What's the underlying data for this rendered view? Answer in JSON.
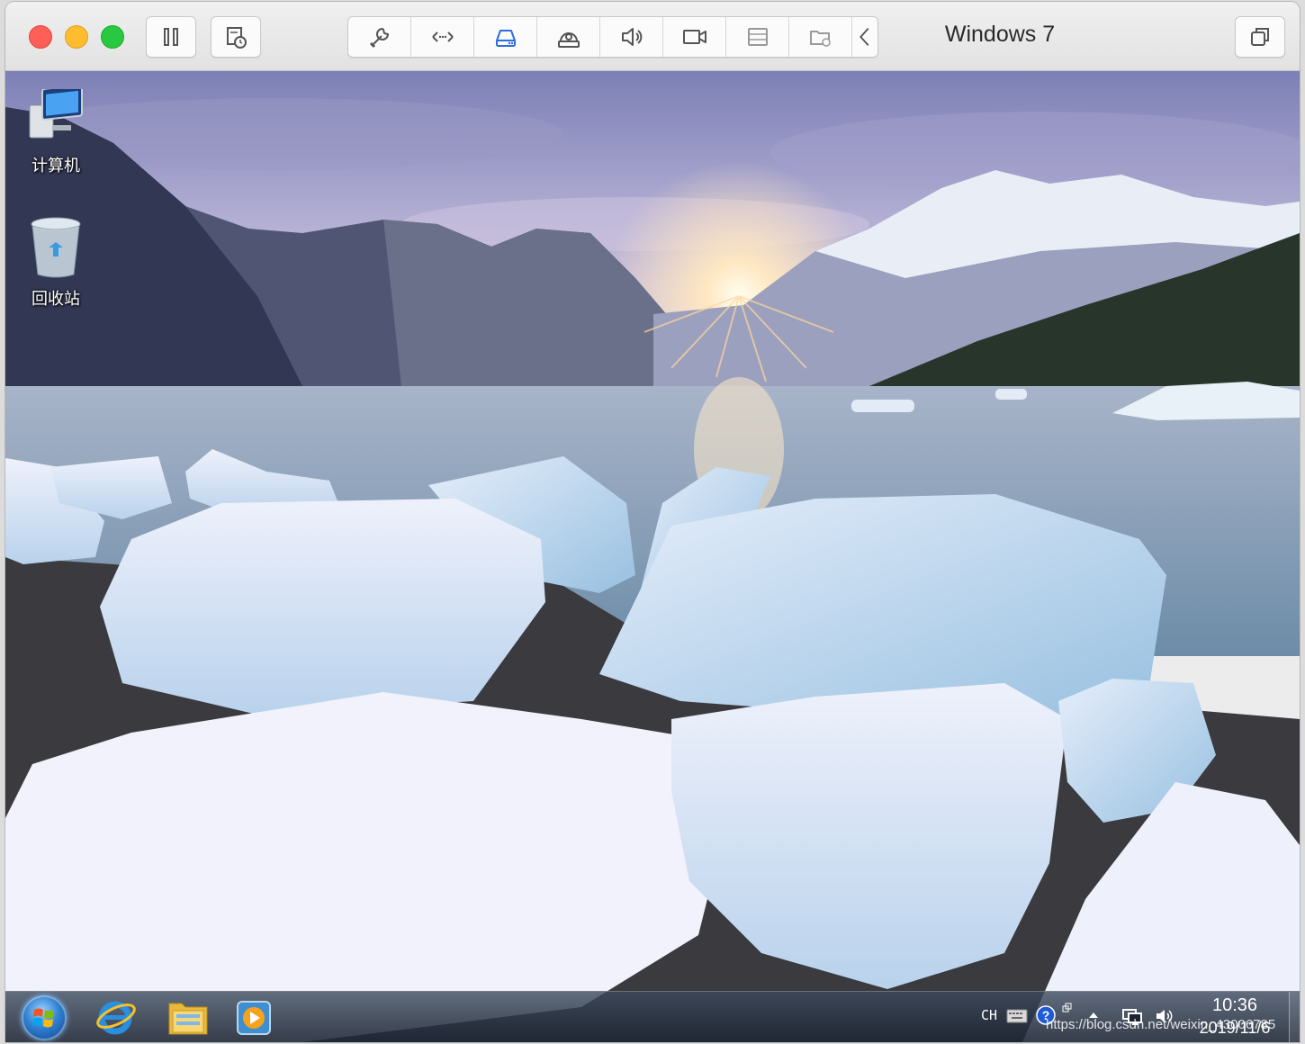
{
  "window": {
    "title": "Windows 7"
  },
  "toolbar": {
    "buttons": [
      {
        "name": "pause",
        "icon": "pause-icon"
      },
      {
        "name": "snapshots",
        "icon": "snapshot-clock-icon"
      }
    ],
    "devices": [
      {
        "name": "settings",
        "icon": "wrench-icon"
      },
      {
        "name": "network",
        "icon": "network-arrows-icon"
      },
      {
        "name": "hard-disk",
        "icon": "hard-disk-icon",
        "active": true
      },
      {
        "name": "cd-dvd",
        "icon": "cd-drive-icon"
      },
      {
        "name": "sound",
        "icon": "speaker-icon"
      },
      {
        "name": "camera",
        "icon": "camera-icon"
      },
      {
        "name": "printer",
        "icon": "printer-icon"
      },
      {
        "name": "shared-folders",
        "icon": "shared-folder-icon"
      },
      {
        "name": "collapse",
        "icon": "chevron-left-icon"
      }
    ],
    "accent_color": "#2d6cdf"
  },
  "desktop": {
    "icons": [
      {
        "label": "计算机",
        "icon": "computer-icon"
      },
      {
        "label": "回收站",
        "icon": "recycle-bin-icon"
      }
    ]
  },
  "taskbar": {
    "pinned": [
      {
        "name": "internet-explorer",
        "icon": "ie-icon"
      },
      {
        "name": "windows-explorer",
        "icon": "folder-icon"
      },
      {
        "name": "media-player",
        "icon": "media-player-icon"
      }
    ],
    "tray": {
      "language": "CH",
      "time": "10:36",
      "date": "2019/11/6"
    }
  },
  "watermark": "https://blog.csdn.net/weixin_43006785"
}
